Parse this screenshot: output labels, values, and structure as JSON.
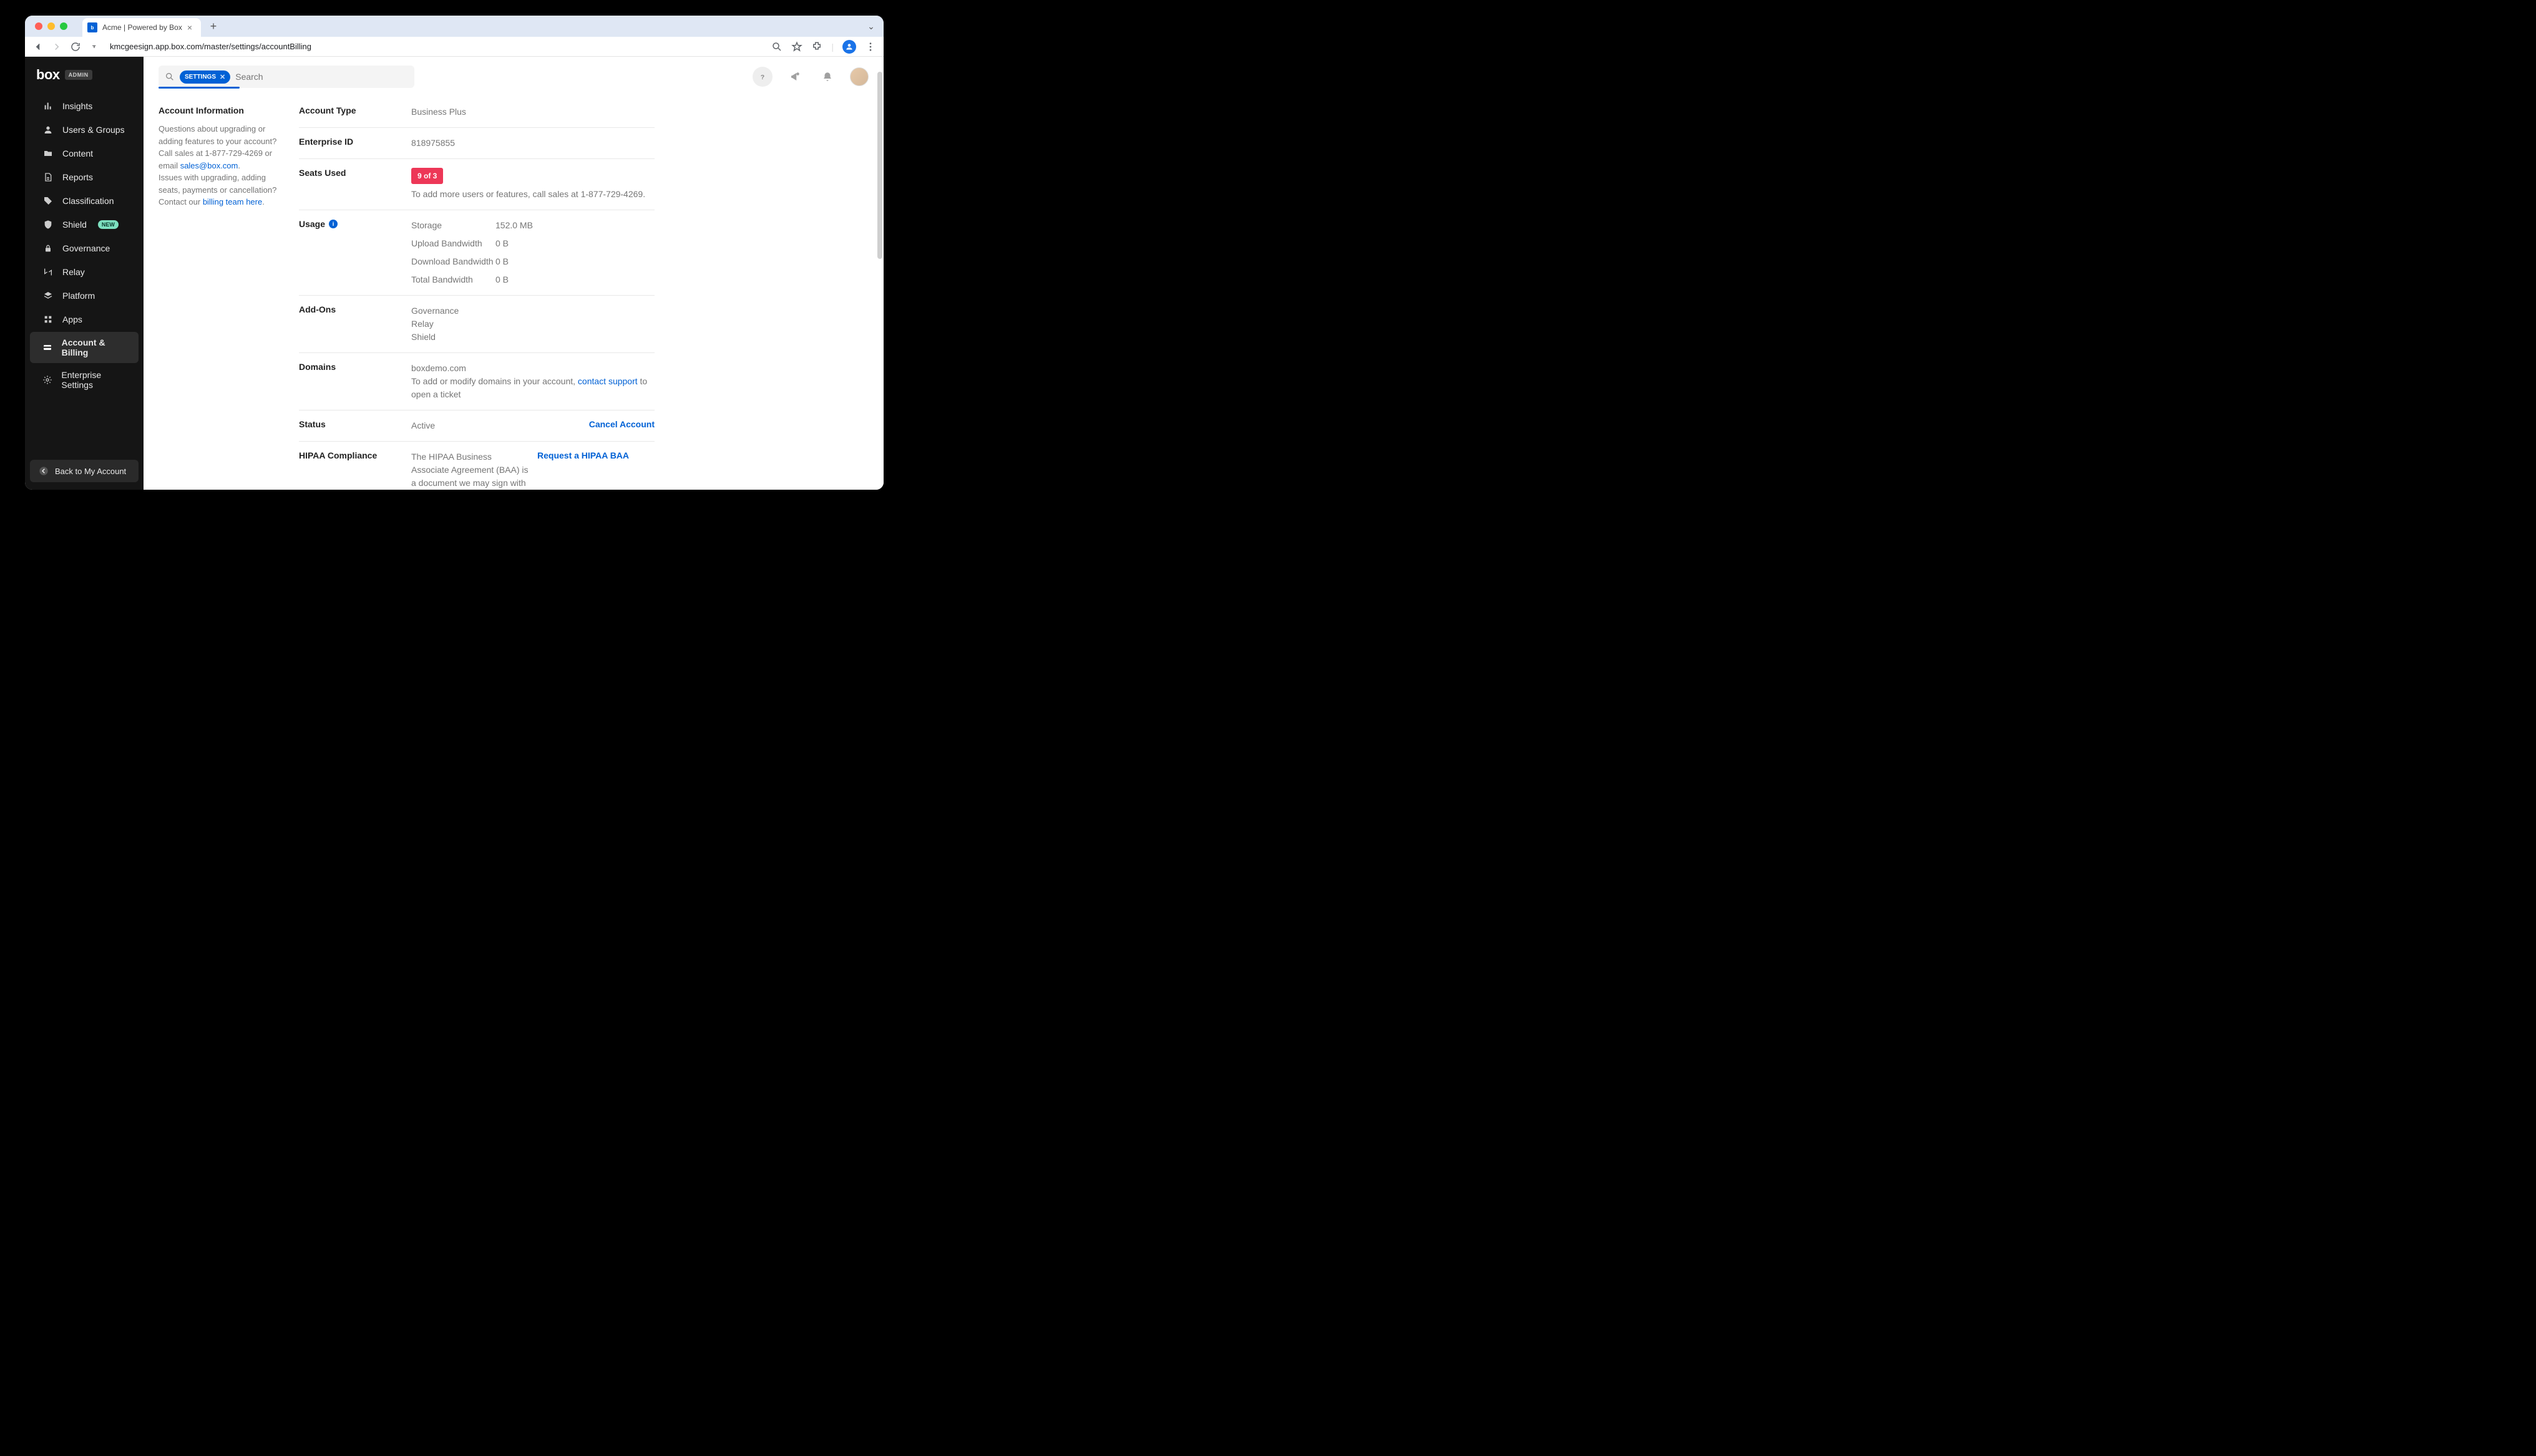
{
  "browser": {
    "tab_title": "Acme | Powered by Box",
    "url": "kmcgeesign.app.box.com/master/settings/accountBilling"
  },
  "sidebar": {
    "logo_text": "box",
    "admin_badge": "ADMIN",
    "items": [
      {
        "label": "Insights",
        "icon": "insights"
      },
      {
        "label": "Users & Groups",
        "icon": "users"
      },
      {
        "label": "Content",
        "icon": "folder"
      },
      {
        "label": "Reports",
        "icon": "reports"
      },
      {
        "label": "Classification",
        "icon": "tag"
      },
      {
        "label": "Shield",
        "icon": "shield",
        "badge": "NEW"
      },
      {
        "label": "Governance",
        "icon": "lock"
      },
      {
        "label": "Relay",
        "icon": "relay"
      },
      {
        "label": "Platform",
        "icon": "platform"
      },
      {
        "label": "Apps",
        "icon": "apps"
      },
      {
        "label": "Account & Billing",
        "icon": "card",
        "active": true
      },
      {
        "label": "Enterprise Settings",
        "icon": "gear"
      }
    ],
    "back_label": "Back to My Account"
  },
  "topbar": {
    "search_chip": "SETTINGS",
    "search_placeholder": "Search"
  },
  "account_info": {
    "heading": "Account Information",
    "desc_1": "Questions about upgrading or adding features to your account? Call sales at 1-877-729-4269 or email ",
    "sales_email": "sales@box.com",
    "desc_2": "Issues with upgrading, adding seats, payments or cancellation? Contact our ",
    "billing_link": "billing team here"
  },
  "fields": {
    "account_type": {
      "label": "Account Type",
      "value": "Business Plus"
    },
    "enterprise_id": {
      "label": "Enterprise ID",
      "value": "818975855"
    },
    "seats_used": {
      "label": "Seats Used",
      "badge": "9 of 3",
      "note": "To add more users or features, call sales at 1-877-729-4269."
    },
    "usage": {
      "label": "Usage",
      "items": [
        {
          "k": "Storage",
          "v": "152.0 MB"
        },
        {
          "k": "Upload Bandwidth",
          "v": "0 B"
        },
        {
          "k": "Download Bandwidth",
          "v": "0 B"
        },
        {
          "k": "Total Bandwidth",
          "v": "0 B"
        }
      ]
    },
    "addons": {
      "label": "Add-Ons",
      "items": [
        "Governance",
        "Relay",
        "Shield"
      ]
    },
    "domains": {
      "label": "Domains",
      "value": "boxdemo.com",
      "note_prefix": "To add or modify domains in your account, ",
      "link": "contact support",
      "note_suffix": " to open a ticket"
    },
    "status": {
      "label": "Status",
      "value": "Active",
      "action": "Cancel Account"
    },
    "hipaa": {
      "label": "HIPAA Compliance",
      "value": "The HIPAA Business Associate Agreement (BAA) is a document we may sign with you acknowledging storage of Personal Health Information (PHI) in Box.",
      "action": "Request a HIPAA BAA"
    }
  }
}
